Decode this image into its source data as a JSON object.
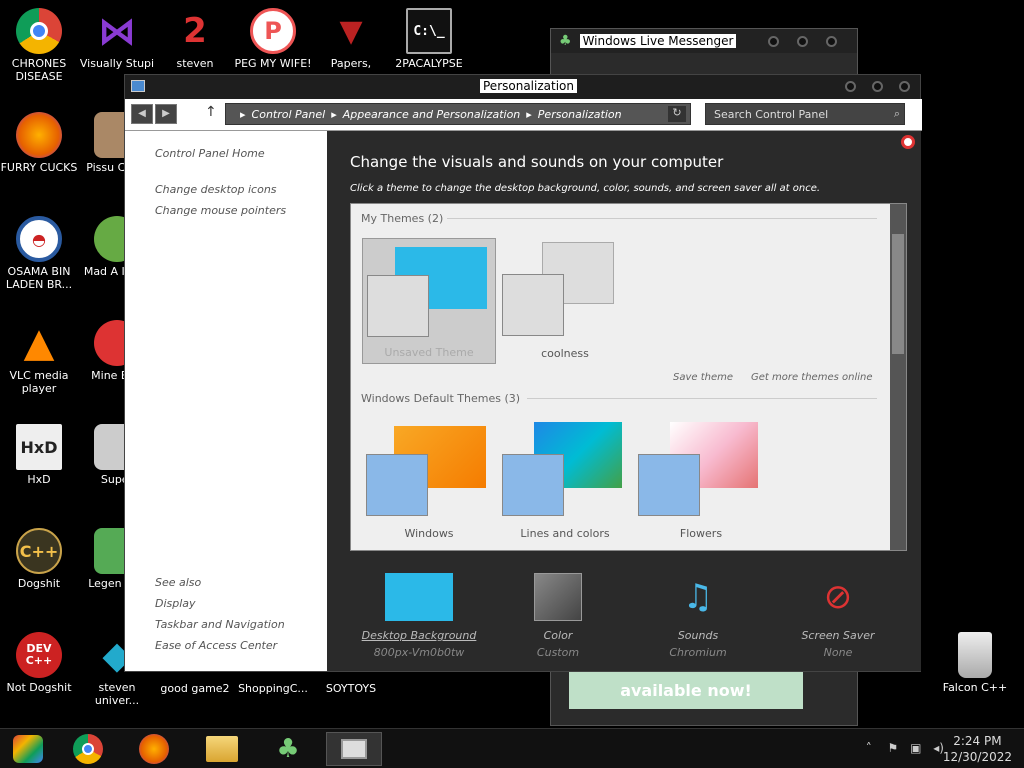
{
  "desktop": {
    "icons": [
      {
        "label": "CHRONES DISEASE",
        "icon": "chrome-icon",
        "color": "#2a7de1"
      },
      {
        "label": "Visually Stupi",
        "icon": "visual-studio-icon",
        "color": "#6a2ba3"
      },
      {
        "label": "steven",
        "icon": "steven-icon",
        "color": "#c32"
      },
      {
        "label": "PEG MY WIFE!",
        "icon": "peggle-icon",
        "color": "#e55"
      },
      {
        "label": "Papers,",
        "icon": "papers-please-icon",
        "color": "#b22"
      },
      {
        "label": "2PACALYPSE",
        "icon": "cmd-icon",
        "color": "#222"
      },
      {
        "label": "FURRY CUCKS",
        "icon": "firefox-icon",
        "color": "#f60"
      },
      {
        "label": "Pissu Chick",
        "icon": "game-icon",
        "color": "#a86"
      },
      {
        "label": "OSAMA BIN LADEN BR...",
        "icon": "obama-logo-icon",
        "color": "#2a5aa0"
      },
      {
        "label": "Mad A IN SP",
        "icon": "angry-birds-space-icon",
        "color": "#6a4"
      },
      {
        "label": "VLC media player",
        "icon": "vlc-icon",
        "color": "#f80"
      },
      {
        "label": "Mine Bird",
        "icon": "angry-birds-icon",
        "color": "#d33"
      },
      {
        "label": "HxD",
        "icon": "hxd-icon",
        "color": "#eee"
      },
      {
        "label": "Super",
        "icon": "game-icon",
        "color": "#ccc"
      },
      {
        "label": "Dogshit",
        "icon": "cpp-icon",
        "color": "#553"
      },
      {
        "label": "Legen Zild",
        "icon": "zelda-icon",
        "color": "#5a5"
      },
      {
        "label": "Not Dogshit",
        "icon": "devcpp-icon",
        "color": "#c22"
      },
      {
        "label": "steven univer...",
        "icon": "gem-icon",
        "color": "#2ac"
      },
      {
        "label": "good game2",
        "icon": "file-icon",
        "color": "#000"
      },
      {
        "label": "ShoppingC...",
        "icon": "file-icon",
        "color": "#000"
      },
      {
        "label": "SOYTOYS",
        "icon": "file-icon",
        "color": "#000"
      },
      {
        "label": "Falcon C++",
        "icon": "recycle-bin-icon",
        "color": "#ddd"
      }
    ]
  },
  "messenger": {
    "title": "Windows Live Messenger",
    "ad_text": "available now!"
  },
  "window": {
    "title": "Personalization",
    "breadcrumb": [
      "Control Panel",
      "Appearance and Personalization",
      "Personalization"
    ],
    "search_placeholder": "Search Control Panel",
    "sidebar": {
      "links": [
        "Control Panel Home",
        "Change desktop icons",
        "Change mouse pointers"
      ],
      "see_also_title": "See also",
      "see_also": [
        "Display",
        "Taskbar and Navigation",
        "Ease of Access Center"
      ]
    },
    "heading": "Change the visuals and sounds on your computer",
    "subheading": "Click a theme to change the desktop background, color, sounds, and screen saver all at once.",
    "my_themes_title": "My Themes (2)",
    "my_themes": [
      "Unsaved Theme",
      "coolness"
    ],
    "save_theme": "Save theme",
    "get_more": "Get more themes online",
    "default_themes_title": "Windows Default Themes (3)",
    "default_themes": [
      "Windows",
      "Lines and colors",
      "Flowers"
    ],
    "bottom": [
      {
        "title": "Desktop Background",
        "value": "800px-Vm0b0tw",
        "icon": "desktop-background-icon"
      },
      {
        "title": "Color",
        "value": "Custom",
        "icon": "color-icon"
      },
      {
        "title": "Sounds",
        "value": "Chromium",
        "icon": "sounds-icon"
      },
      {
        "title": "Screen Saver",
        "value": "None",
        "icon": "screen-saver-icon"
      }
    ]
  },
  "taskbar": {
    "items": [
      "start-icon",
      "chrome-icon",
      "firefox-icon",
      "file-explorer-icon",
      "messenger-icon",
      "control-panel-icon"
    ],
    "time": "2:24 PM",
    "date": "12/30/2022"
  }
}
